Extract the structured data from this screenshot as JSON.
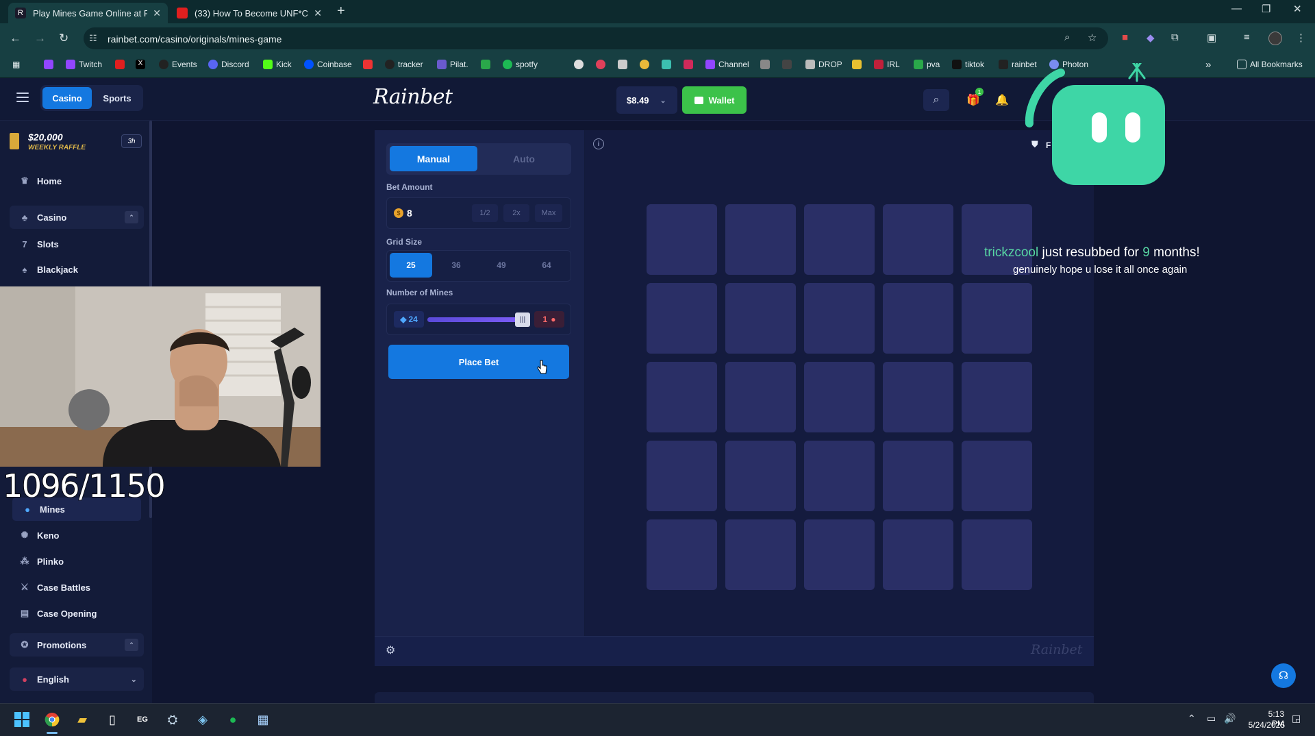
{
  "browser": {
    "tabs": [
      {
        "title": "Play Mines Game Online at Rai",
        "active": true
      },
      {
        "title": "(33) How To Become UNF*CKW",
        "active": false
      }
    ],
    "new_tab": "+",
    "url": "rainbet.com/casino/originals/mines-game",
    "bookmarks": [
      "Twitch",
      "Events",
      "Discord",
      "Kick",
      "Coinbase",
      "tracker",
      "Pilat.",
      "spotfy",
      "Channel",
      "DROP",
      "IRL",
      "pva",
      "tiktok",
      "rainbet",
      "Photon"
    ],
    "all_bookmarks": "All Bookmarks",
    "overflow": "»"
  },
  "header": {
    "toggle": {
      "casino": "Casino",
      "sports": "Sports"
    },
    "logo": "Rainbet",
    "balance": "$8.49",
    "wallet": "Wallet",
    "gift_badge": "1"
  },
  "sidebar": {
    "raffle": {
      "amount": "$20,000",
      "label": "WEEKLY RAFFLE",
      "time": "3h"
    },
    "home": "Home",
    "casino": "Casino",
    "slots": "Slots",
    "blackjack": "Blackjack",
    "mines": "Mines",
    "keno": "Keno",
    "plinko": "Plinko",
    "case_battles": "Case Battles",
    "case_opening": "Case Opening",
    "promotions": "Promotions",
    "language": "English"
  },
  "stream": {
    "counter": "1096/1150",
    "alert": {
      "user": "trickzcool",
      "text_a": " just resubbed for ",
      "months": "9",
      "text_b": " months!",
      "message": "genuinely hope u lose it all once again"
    }
  },
  "game": {
    "modes": {
      "manual": "Manual",
      "auto": "Auto"
    },
    "bet_amount_label": "Bet Amount",
    "bet_amount": "8",
    "bet_buttons": {
      "half": "1/2",
      "double": "2x",
      "max": "Max"
    },
    "grid_size_label": "Grid Size",
    "grid_sizes": [
      "25",
      "36",
      "49",
      "64"
    ],
    "selected_grid": "25",
    "mines_label": "Number of Mines",
    "gems": "24",
    "mines": "1",
    "mines_fraction": 0.96,
    "place_bet": "Place Bet",
    "fairness_label": "F",
    "watermark": "Rainbet",
    "tiles": 25
  },
  "taskbar": {
    "time": "5:13 PM",
    "date": "5/24/2025"
  },
  "colors": {
    "accent": "#1478e0",
    "wallet": "#3cc24a",
    "tile": "#2a2f66",
    "alert_green": "#58d7a4"
  }
}
